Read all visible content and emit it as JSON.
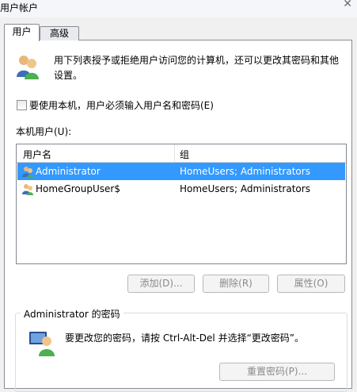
{
  "window": {
    "title": "用户帐户",
    "close_glyph": "✕"
  },
  "tabs": [
    {
      "label": "用户"
    },
    {
      "label": "高级"
    }
  ],
  "intro": {
    "text": "用下列表授予或拒绝用户访问您的计算机，还可以更改其密码和其他设置。"
  },
  "require_login": {
    "label": "要使用本机，用户必须输入用户名和密码(E)",
    "checked": false
  },
  "users_list": {
    "caption": "本机用户(U):",
    "columns": [
      "用户名",
      "组"
    ],
    "rows": [
      {
        "name": "Administrator",
        "group": "HomeUsers; Administrators",
        "selected": true
      },
      {
        "name": "HomeGroupUser$",
        "group": "HomeUsers; Administrators",
        "selected": false
      }
    ]
  },
  "buttons": {
    "add": "添加(D)...",
    "delete": "删除(R)",
    "properties": "属性(O)"
  },
  "password_section": {
    "legend": "Administrator 的密码",
    "text": "要更改您的密码，请按 Ctrl-Alt-Del 并选择“更改密码”。",
    "reset_button": "重置密码(P)..."
  },
  "icons": [
    "users-icon",
    "user-icon",
    "password-user-icon"
  ],
  "colors": {
    "selection": "#3399ff",
    "panel": "#ffffff",
    "frame": "#f0f0f0"
  }
}
